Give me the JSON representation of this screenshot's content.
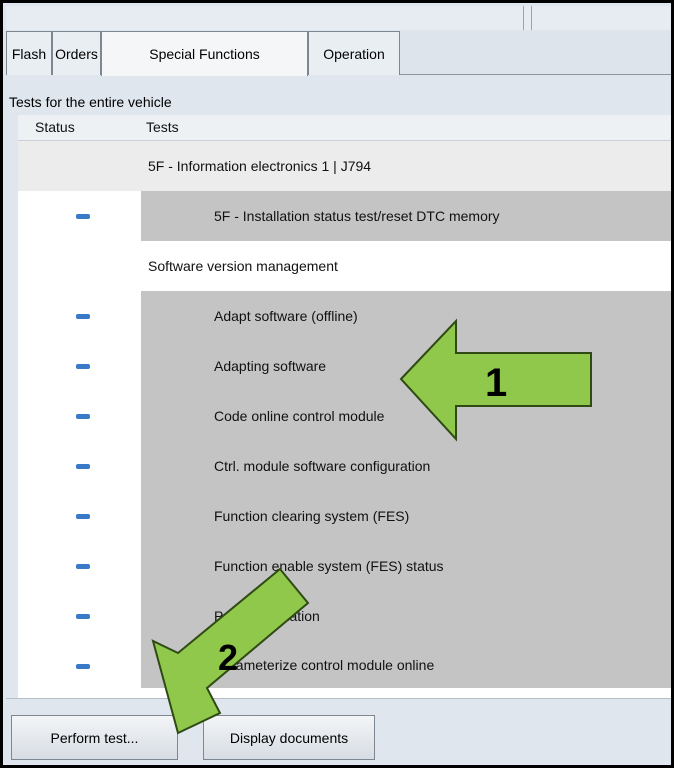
{
  "tabs": [
    {
      "label": "Flash"
    },
    {
      "label": "Orders"
    },
    {
      "label": "Special Functions"
    },
    {
      "label": "Operation"
    }
  ],
  "section_label": "Tests for the entire vehicle",
  "table": {
    "headers": {
      "status": "Status",
      "tests": "Tests"
    },
    "rows": [
      {
        "label": "5F - Information electronics 1 | J794"
      },
      {
        "label": "5F - Installation status test/reset DTC memory"
      },
      {
        "label": "Software version management"
      },
      {
        "label": "Adapt software (offline)"
      },
      {
        "label": "Adapting software"
      },
      {
        "label": "Code online control module"
      },
      {
        "label": "Ctrl. module software configuration"
      },
      {
        "label": "Function clearing system (FES)"
      },
      {
        "label": "Function enable system (FES) status"
      },
      {
        "label": "Parameterization"
      },
      {
        "label": "Parameterize control module online"
      }
    ]
  },
  "buttons": {
    "perform_test": "Perform test...",
    "display_documents": "Display documents"
  },
  "callouts": {
    "one": "1",
    "two": "2",
    "arrow_color": "#8fc84a"
  },
  "colors": {
    "status_dash": "#3a78c8",
    "row_gray": "#c4c4c4"
  }
}
